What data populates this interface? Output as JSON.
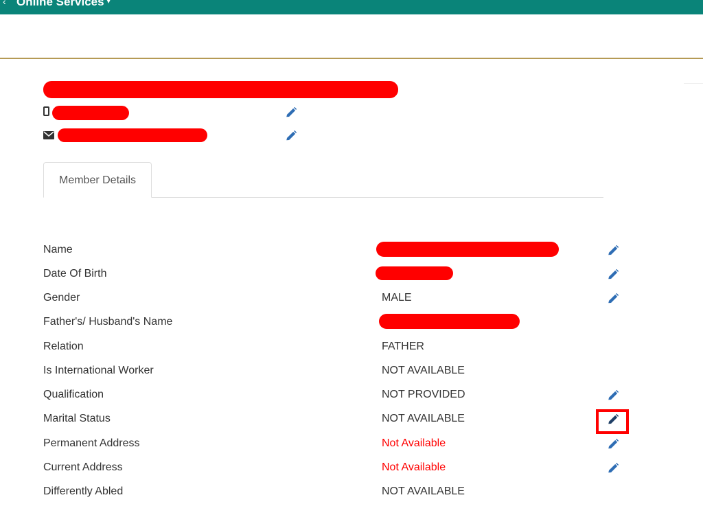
{
  "topbar": {
    "menu_label": "Online Services",
    "caret": "▾",
    "left_arrow": "‹",
    "color": "#0a8479"
  },
  "tabs": [
    {
      "label": "Member Details"
    }
  ],
  "member_details": {
    "rows": [
      {
        "label": "Name",
        "value": "",
        "redacted": true,
        "editable": true
      },
      {
        "label": "Date Of Birth",
        "value": "",
        "redacted": true,
        "editable": true
      },
      {
        "label": "Gender",
        "value": "MALE",
        "redacted": false,
        "editable": true
      },
      {
        "label": "Father's/ Husband's Name",
        "value": "",
        "redacted": true,
        "editable": false
      },
      {
        "label": "Relation",
        "value": "FATHER",
        "redacted": false,
        "editable": false
      },
      {
        "label": "Is International Worker",
        "value": "NOT AVAILABLE",
        "redacted": false,
        "editable": false
      },
      {
        "label": "Qualification",
        "value": "NOT PROVIDED",
        "redacted": false,
        "editable": true
      },
      {
        "label": "Marital Status",
        "value": "NOT AVAILABLE",
        "redacted": false,
        "editable": true,
        "highlighted": true
      },
      {
        "label": "Permanent Address",
        "value": "Not Available",
        "redacted": false,
        "editable": true,
        "value_color": "#ff0000"
      },
      {
        "label": "Current Address",
        "value": "Not Available",
        "redacted": false,
        "editable": true,
        "value_color": "#ff0000"
      },
      {
        "label": "Differently Abled",
        "value": "NOT AVAILABLE",
        "redacted": false,
        "editable": false
      }
    ]
  },
  "icons": {
    "phone": "mobile-phone-icon",
    "email": "envelope-icon",
    "edit": "pencil-icon"
  },
  "colors": {
    "redaction": "#ff0000",
    "highlight": "#ff0000",
    "edit_icon": "#2e6db4",
    "divider": "#b59a55"
  }
}
